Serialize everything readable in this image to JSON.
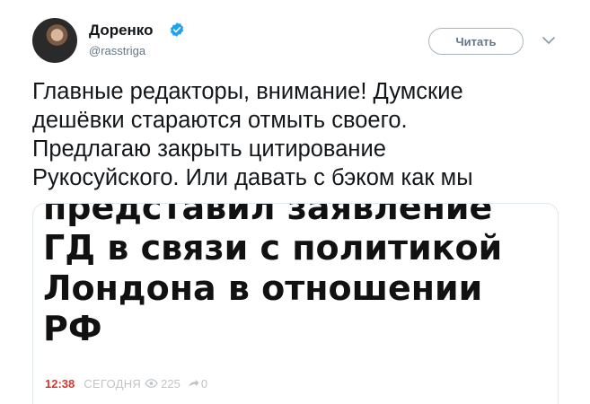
{
  "tweet": {
    "author_name": "Доренко",
    "handle": "@rasstriga",
    "follow_label": "Читать",
    "text_lines": [
      "Главные редакторы, внимание! Думские",
      "дешёвки стараются отмыть своего.",
      "Предлагаю закрыть цитирование",
      "Рукосуйского. Или давать с бэком как мы"
    ]
  },
  "media": {
    "headline_lines": [
      "представил заявление",
      "ГД в связи с политикой",
      "Лондона в отношении",
      "РФ"
    ],
    "time": "12:38",
    "date": "СЕГОДНЯ",
    "views": "225",
    "shares": "0"
  },
  "icons": {
    "verified": "verified-badge-icon",
    "chevron": "chevron-down-icon",
    "views": "eye-icon",
    "shares": "share-icon"
  },
  "colors": {
    "verified": "#1da1f2",
    "time_accent": "#d9362b",
    "muted": "#657786"
  }
}
